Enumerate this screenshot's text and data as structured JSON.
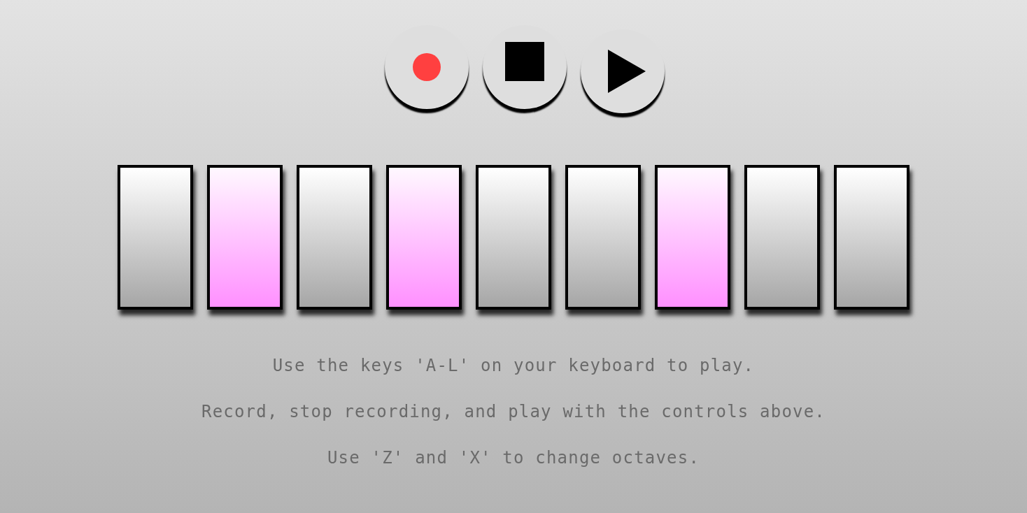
{
  "controls": [
    {
      "kind": "record"
    },
    {
      "kind": "stop"
    },
    {
      "kind": "play"
    }
  ],
  "keys": [
    {
      "active": false
    },
    {
      "active": true
    },
    {
      "active": false
    },
    {
      "active": true
    },
    {
      "active": false
    },
    {
      "active": false
    },
    {
      "active": true
    },
    {
      "active": false
    },
    {
      "active": false
    }
  ],
  "instructions": [
    "Use the keys 'A-L' on your keyboard to play.",
    "Record, stop recording, and play with the controls above.",
    "Use 'Z' and 'X' to change octaves."
  ]
}
